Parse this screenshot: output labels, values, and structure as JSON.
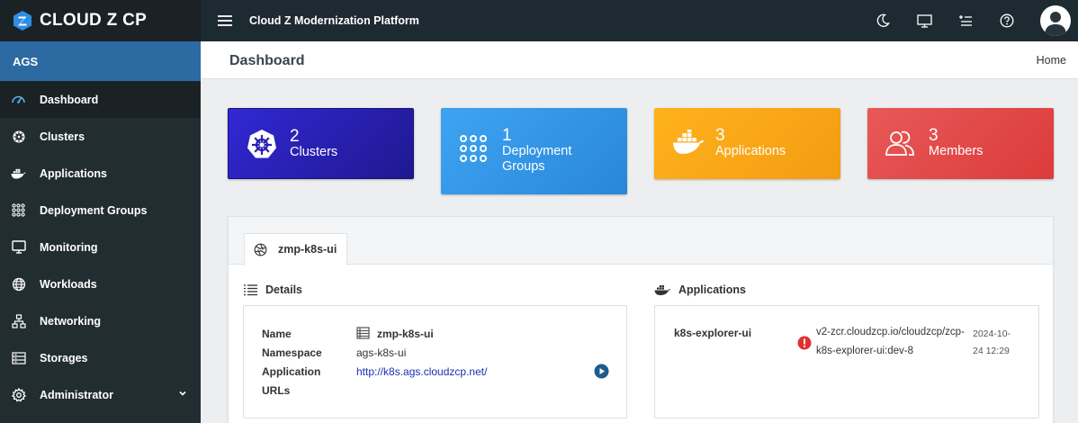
{
  "brand": {
    "name": "CLOUD Z CP"
  },
  "sidebar": {
    "org": "AGS",
    "items": [
      {
        "label": "Dashboard",
        "icon": "dashboard-icon"
      },
      {
        "label": "Clusters",
        "icon": "helm-icon"
      },
      {
        "label": "Applications",
        "icon": "docker-icon"
      },
      {
        "label": "Deployment Groups",
        "icon": "grid-dots-icon"
      },
      {
        "label": "Monitoring",
        "icon": "monitor-icon"
      },
      {
        "label": "Workloads",
        "icon": "globe-icon"
      },
      {
        "label": "Networking",
        "icon": "network-icon"
      },
      {
        "label": "Storages",
        "icon": "storage-icon"
      },
      {
        "label": "Administrator",
        "icon": "gear-icon"
      }
    ]
  },
  "topbar": {
    "title": "Cloud Z Modernization Platform",
    "icons": [
      "moon-icon",
      "desktop-icon",
      "list-plus-icon",
      "help-icon",
      "user-avatar"
    ]
  },
  "header": {
    "title": "Dashboard",
    "breadcrumb": "Home"
  },
  "stats": [
    {
      "number": "2",
      "label": "Clusters",
      "color": "#2a21b8"
    },
    {
      "number": "1",
      "label": "Deployment Groups",
      "label_line1": "Deployment",
      "label_line2": "Groups",
      "color": "#3498e6"
    },
    {
      "number": "3",
      "label": "Applications",
      "color": "#f5a416"
    },
    {
      "number": "3",
      "label": "Members",
      "color": "#e14747"
    }
  ],
  "cluster_panel": {
    "tab": "zmp-k8s-ui",
    "details": {
      "title": "Details",
      "name_label": "Name",
      "name_value": "zmp-k8s-ui",
      "namespace_label": "Namespace",
      "namespace_value": "ags-k8s-ui",
      "app_urls_label_line1": "Application",
      "app_urls_label_line2": "URLs",
      "app_url": "http://k8s.ags.cloudzcp.net/"
    },
    "applications": {
      "title": "Applications",
      "app_name": "k8s-explorer-ui",
      "image_line1": "v2-zcr.cloudzcp.io/cloudzcp/zcp-",
      "image_line2": "k8s-explorer-ui:dev-8",
      "date_line1": "2024-10-",
      "date_line2": "24 12:29",
      "status_color": "#e03131"
    }
  }
}
